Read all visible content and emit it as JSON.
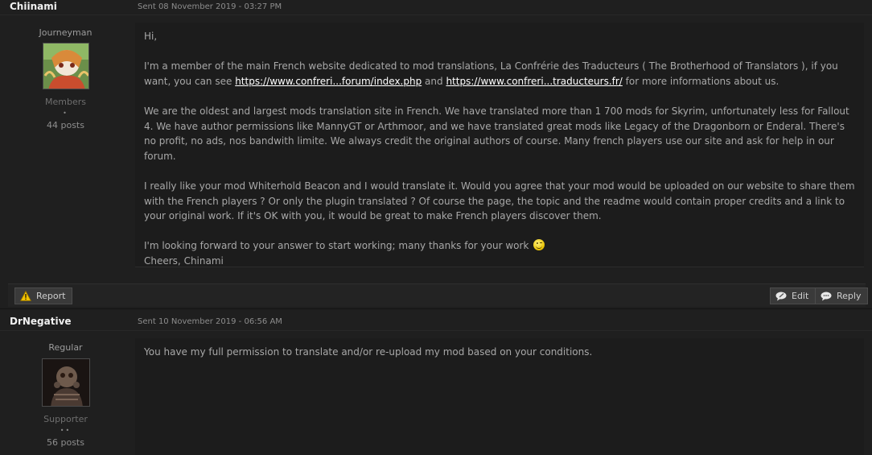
{
  "posts": [
    {
      "author": "Chiinami",
      "sent": "Sent 08 November 2019 - 03:27 PM",
      "rank": "Journeyman",
      "group": "Members",
      "pips": "•",
      "post_count": "44 posts",
      "greeting": "Hi,",
      "para1_a": "I'm a member of the main French website dedicated to mod translations, La Confrérie des Traducteurs ( The Brotherhood of Translators ), if you want, you can see ",
      "link1": "https://www.confreri...forum/index.php",
      "para1_and": " and ",
      "link2": "https://www.confreri...traducteurs.fr/",
      "para1_b": " for more informations about us.",
      "para2": "We are the oldest and largest mods translation site in French. We have translated more than 1 700 mods for Skyrim, unfortunately less for Fallout 4. We have author permissions like MannyGT or Arthmoor, and we have translated great mods like Legacy of the Dragonborn or Enderal. There's no profit, no ads, nos bandwith limite. We always credit the original authors of course. Many french players use our site and ask for help in our forum.",
      "para3": "I really like your mod Whiterhold Beacon and I would translate it. Would you agree that your mod would be uploaded on our website to share them with the French players ? Or only the plugin translated ? Of course the page, the topic and the readme would contain proper credits and a link to your original work. If it's OK with you, it would be great to make French players discover them.",
      "para4": "I'm looking forward to your answer to start working; many thanks for your work ",
      "sign": "Cheers, Chinami"
    },
    {
      "author": "DrNegative",
      "sent": "Sent 10 November 2019 - 06:56 AM",
      "rank": "Regular",
      "group": "Supporter",
      "pips": "••",
      "post_count": "56 posts",
      "body": "You have my full permission to translate and/or re-upload my mod based on your conditions."
    }
  ],
  "toolbar": {
    "report_label": "Report",
    "edit_label": "Edit",
    "reply_label": "Reply"
  },
  "icons": {
    "report": "warning-icon",
    "edit": "edit-bubble-icon",
    "reply": "reply-bubble-icon",
    "smiley": "wink-smiley-icon"
  },
  "colors": {
    "background": "#1e1e1e",
    "author_name": "#f0f0f0",
    "link": "#ffffff",
    "warning": "#f2c200"
  }
}
